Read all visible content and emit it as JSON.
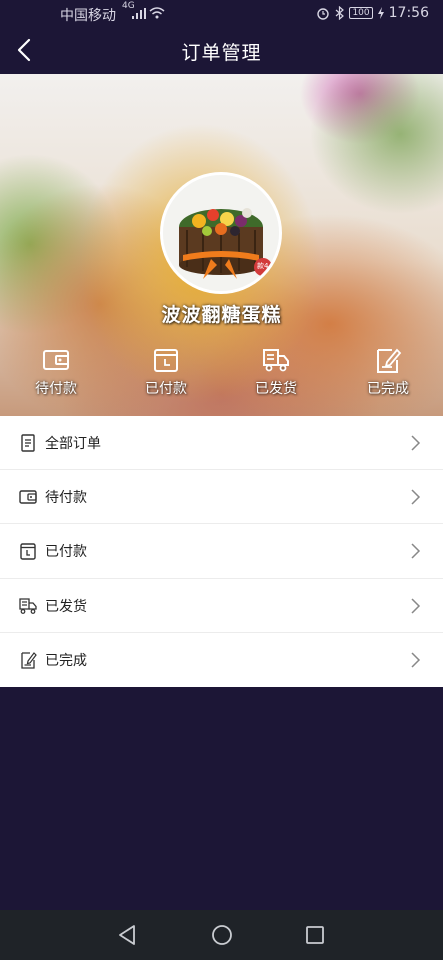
{
  "status_bar": {
    "carrier": "中国移动",
    "network": "4G",
    "battery": "100",
    "time": "17:56"
  },
  "header": {
    "title": "订单管理"
  },
  "shop": {
    "name": "波波翻糖蛋糕",
    "avatar_badge": "款4"
  },
  "order_status": [
    {
      "label": "待付款",
      "icon": "wallet-icon"
    },
    {
      "label": "已付款",
      "icon": "calendar-icon"
    },
    {
      "label": "已发货",
      "icon": "delivery-truck-icon"
    },
    {
      "label": "已完成",
      "icon": "checklist-edit-icon"
    }
  ],
  "menu": [
    {
      "label": "全部订单",
      "icon": "document-icon"
    },
    {
      "label": "待付款",
      "icon": "wallet-icon"
    },
    {
      "label": "已付款",
      "icon": "calendar-icon"
    },
    {
      "label": "已发货",
      "icon": "delivery-truck-icon"
    },
    {
      "label": "已完成",
      "icon": "checklist-edit-icon"
    }
  ],
  "colors": {
    "background": "#1c1636",
    "header": "#1c1636",
    "list_bg": "#ffffff",
    "system_nav": "#1f2328"
  }
}
